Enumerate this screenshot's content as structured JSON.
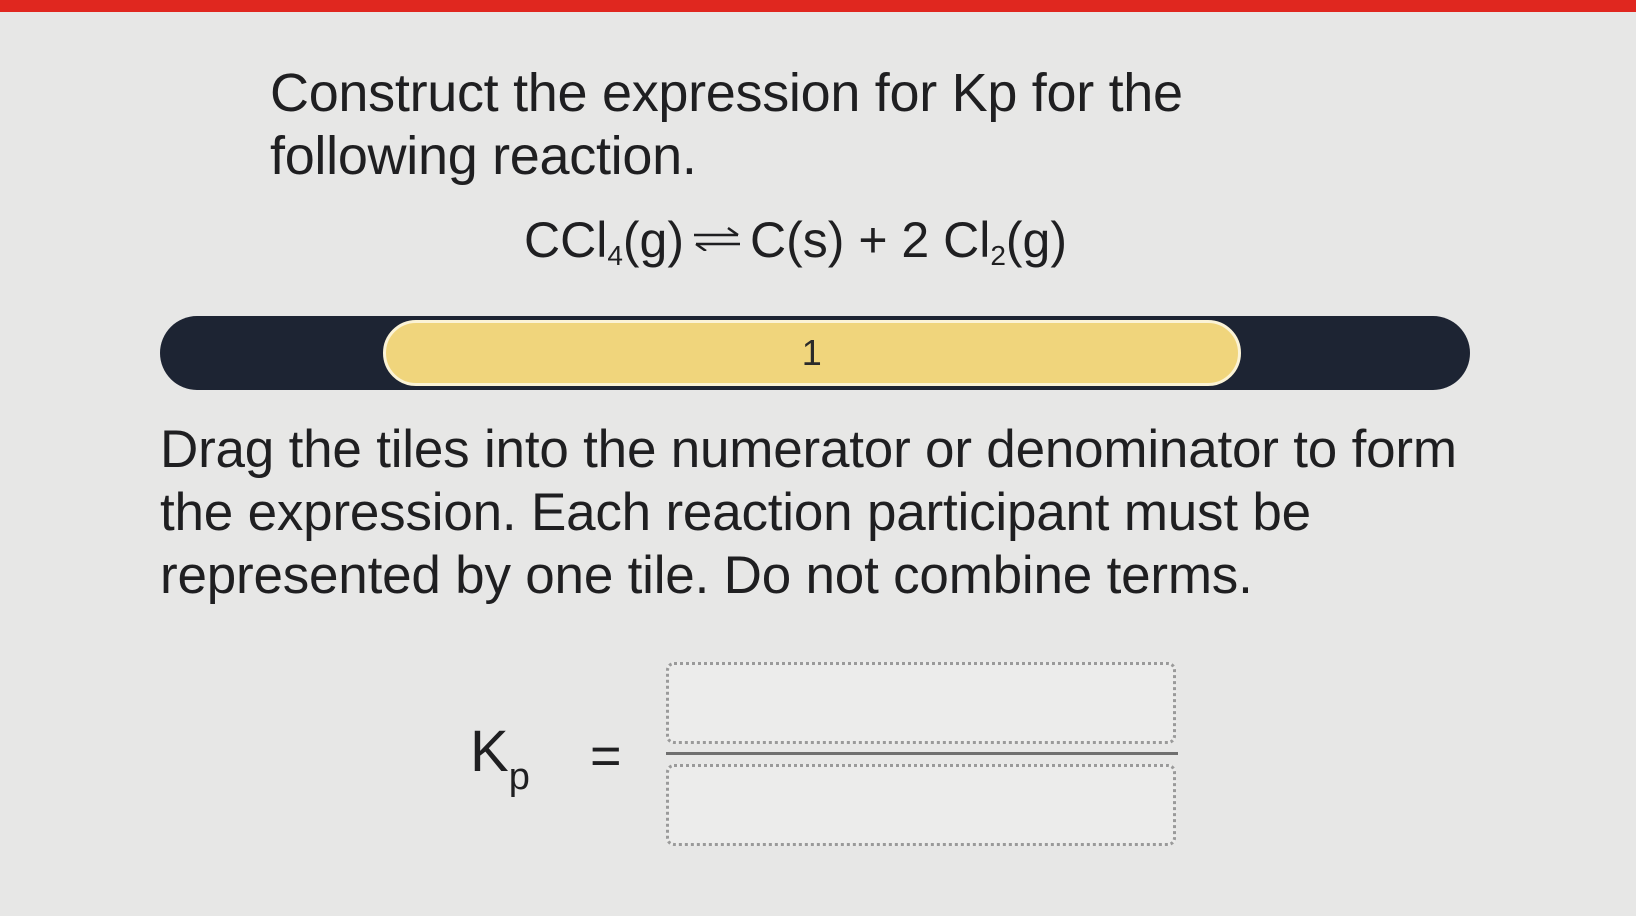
{
  "header": {
    "accent_color": "#e0271f"
  },
  "question": {
    "prompt": "Construct the expression for Kp for the following reaction."
  },
  "reaction": {
    "reactant": "CCl",
    "reactant_sub": "4",
    "reactant_state": "(g)",
    "product1": "C(s) + 2 Cl",
    "product1_sub": "2",
    "product1_state": "(g)",
    "arrow_icon": "equilibrium-arrow-icon"
  },
  "progress": {
    "label": "1",
    "track_color": "#1d2433",
    "fill_color": "#f0d57c",
    "segment_start_fraction": 0.17,
    "segment_end_fraction": 0.825
  },
  "instructions": {
    "text": "Drag the tiles into the numerator or denominator to form the expression. Each reaction participant must be represented by one tile. Do not combine terms."
  },
  "expression": {
    "k_symbol": "K",
    "k_subscript": "p",
    "equals": "="
  }
}
